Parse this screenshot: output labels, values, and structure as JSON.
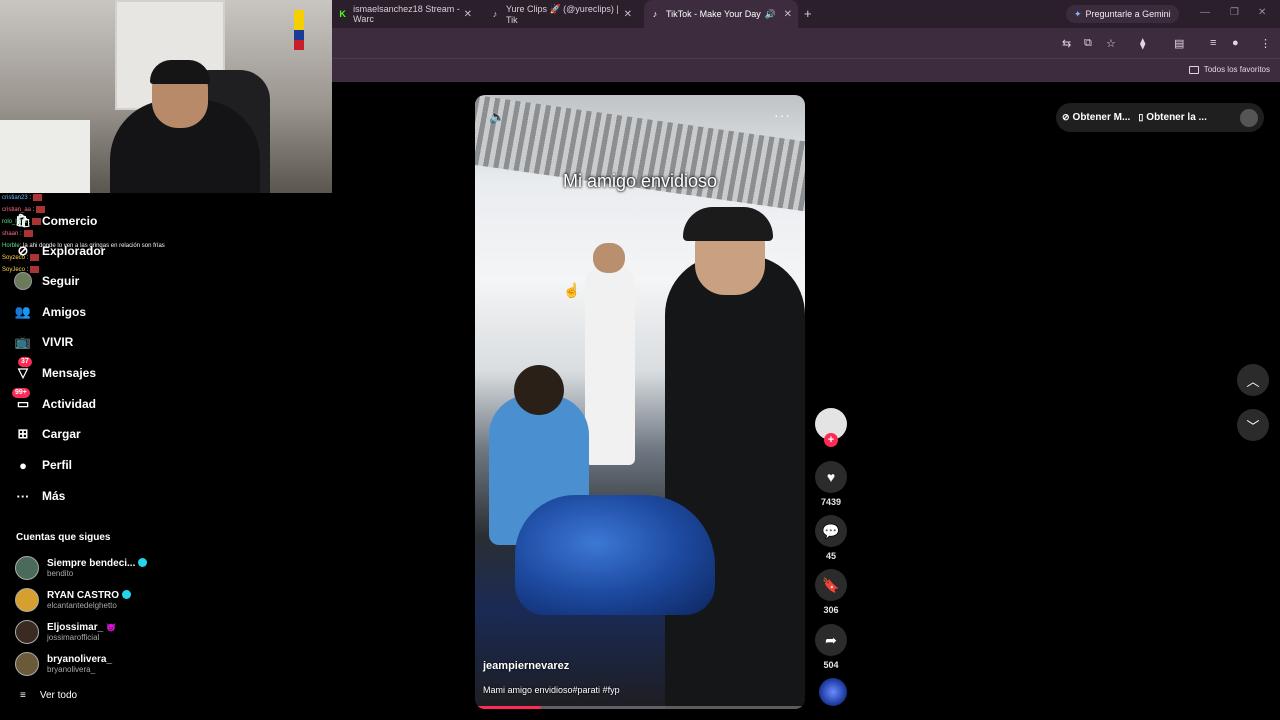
{
  "browser": {
    "tabs": [
      {
        "label": "ismaelsanchez18 Stream - Warc",
        "favicon": "K"
      },
      {
        "label": "Yure Clips 🚀 (@yureclips) | Tik",
        "favicon": "♪"
      },
      {
        "label": "TikTok - Make Your Day",
        "favicon": "♪",
        "active": true
      }
    ],
    "gemini_label": "Preguntarle a Gemini",
    "bookmarks_folder": "Todos los favoritos"
  },
  "chat": [
    {
      "user": "cristian23",
      "text": ":"
    },
    {
      "user": "cristian_aa",
      "text": ":"
    },
    {
      "user": "rolo_luna",
      "text": ":"
    },
    {
      "user": "shaan",
      "text": ":"
    },
    {
      "user": "Horble",
      "text": ": la ahi donde lo ven a las gringas en relación son frías"
    },
    {
      "user": "Soyzeco",
      "text": ":"
    },
    {
      "user": "SoyJeco",
      "text": ":"
    }
  ],
  "sidebar": {
    "items": [
      {
        "label": "Comercio",
        "icon": "shop-icon"
      },
      {
        "label": "Explorador",
        "icon": "compass-icon"
      },
      {
        "label": "Seguir",
        "icon": "following-avatar-icon"
      },
      {
        "label": "Amigos",
        "icon": "friends-icon"
      },
      {
        "label": "VIVIR",
        "icon": "live-icon"
      },
      {
        "label": "Mensajes",
        "icon": "messages-icon",
        "badge": "37"
      },
      {
        "label": "Actividad",
        "icon": "activity-icon",
        "badge": "99+"
      },
      {
        "label": "Cargar",
        "icon": "upload-icon"
      },
      {
        "label": "Perfil",
        "icon": "profile-icon"
      },
      {
        "label": "Más",
        "icon": "more-icon"
      }
    ],
    "following_title": "Cuentas que sigues",
    "accounts": [
      {
        "name": "Siempre bendeci...",
        "handle": "bendito",
        "verified": true
      },
      {
        "name": "RYAN CASTRO",
        "handle": "elcantantedelghetto",
        "verified": true
      },
      {
        "name": "Eljossimar_",
        "handle": "jossimarofficial",
        "emoji": "😈"
      },
      {
        "name": "bryanolivera_",
        "handle": "bryanolivera_"
      }
    ],
    "see_all": "Ver todo"
  },
  "video": {
    "title": "Mi amigo envidioso",
    "author": "jeampiernevarez",
    "caption": "Mami amigo envidioso#parati #fyp",
    "progress": 0.2
  },
  "actions": {
    "likes": "7439",
    "comments": "45",
    "saves": "306",
    "shares": "504"
  },
  "top_right": {
    "pill1": "Obtener M...",
    "pill2": "Obtener la ..."
  }
}
